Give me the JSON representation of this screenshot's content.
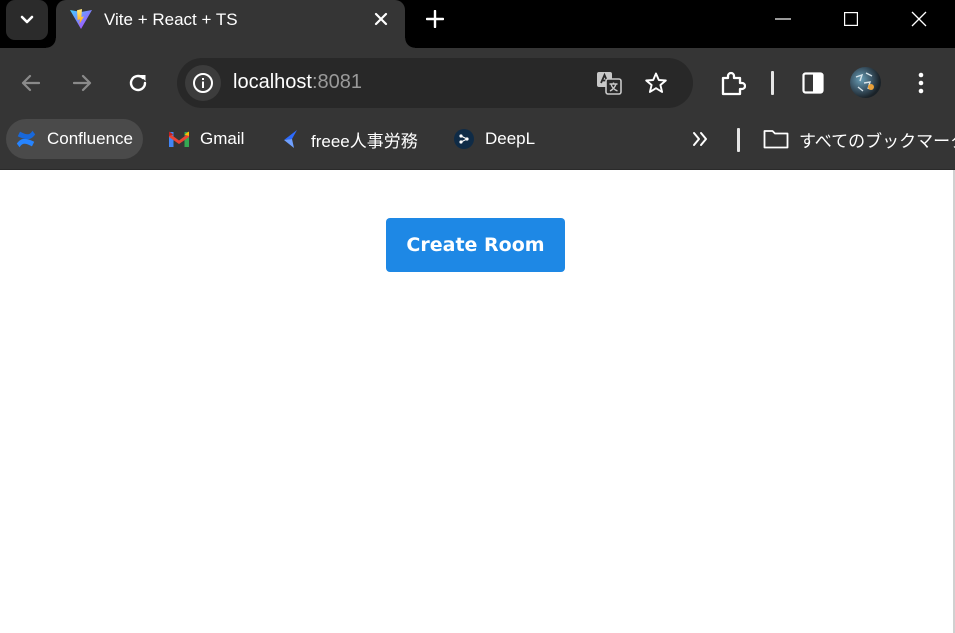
{
  "browser": {
    "tab": {
      "title": "Vite + React + TS"
    },
    "address_bar": {
      "host": "localhost",
      "port": ":8081"
    },
    "bookmarks": [
      {
        "label": "Confluence",
        "icon": "confluence-icon"
      },
      {
        "label": "Gmail",
        "icon": "gmail-icon"
      },
      {
        "label": "freee人事労務",
        "icon": "freee-icon"
      },
      {
        "label": "DeepL",
        "icon": "deepl-icon"
      }
    ],
    "all_bookmarks_label": "すべてのブックマーク"
  },
  "page": {
    "create_room_label": "Create Room"
  },
  "colors": {
    "primary_button": "#1e88e5",
    "chrome_dark": "#353535",
    "titlebar": "#000000"
  }
}
